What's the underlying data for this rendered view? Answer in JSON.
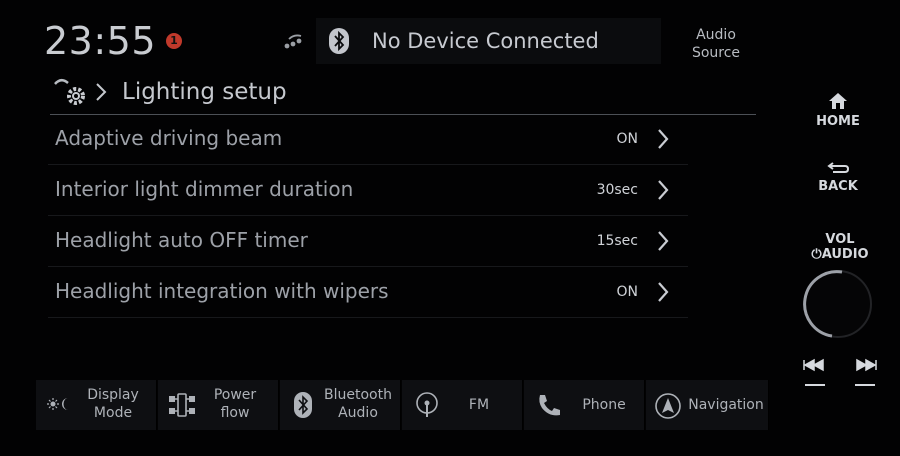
{
  "status_bar": {
    "time": "23:55",
    "notification_count": "1",
    "bluetooth_status": "No Device Connected",
    "audio_source_line1": "Audio",
    "audio_source_line2": "Source"
  },
  "header": {
    "icon": "settings-gear-icon",
    "title": "Lighting setup"
  },
  "settings": [
    {
      "label": "Adaptive driving beam",
      "value": "ON"
    },
    {
      "label": "Interior light dimmer duration",
      "value": "30sec"
    },
    {
      "label": "Headlight auto OFF timer",
      "value": "15sec"
    },
    {
      "label": "Headlight integration with wipers",
      "value": "ON"
    }
  ],
  "bottom_bar": [
    {
      "icon": "day-night-icon",
      "line1": "Display",
      "line2": "Mode"
    },
    {
      "icon": "power-flow-icon",
      "line1": "Power",
      "line2": "flow"
    },
    {
      "icon": "bluetooth-icon",
      "line1": "Bluetooth",
      "line2": "Audio"
    },
    {
      "icon": "radio-antenna-icon",
      "line1": "FM",
      "line2": ""
    },
    {
      "icon": "phone-icon",
      "line1": "Phone",
      "line2": ""
    },
    {
      "icon": "navigation-icon",
      "line1": "Navigation",
      "line2": ""
    }
  ],
  "hardware": {
    "home_label": "HOME",
    "back_label": "BACK",
    "vol_label": "VOL",
    "audio_label": "AUDIO"
  },
  "colors": {
    "background": "#020203",
    "text": "#d8dbe0",
    "muted_text": "#9da1a8",
    "notification": "#c0392b",
    "bar_background": "#0e0f12"
  }
}
